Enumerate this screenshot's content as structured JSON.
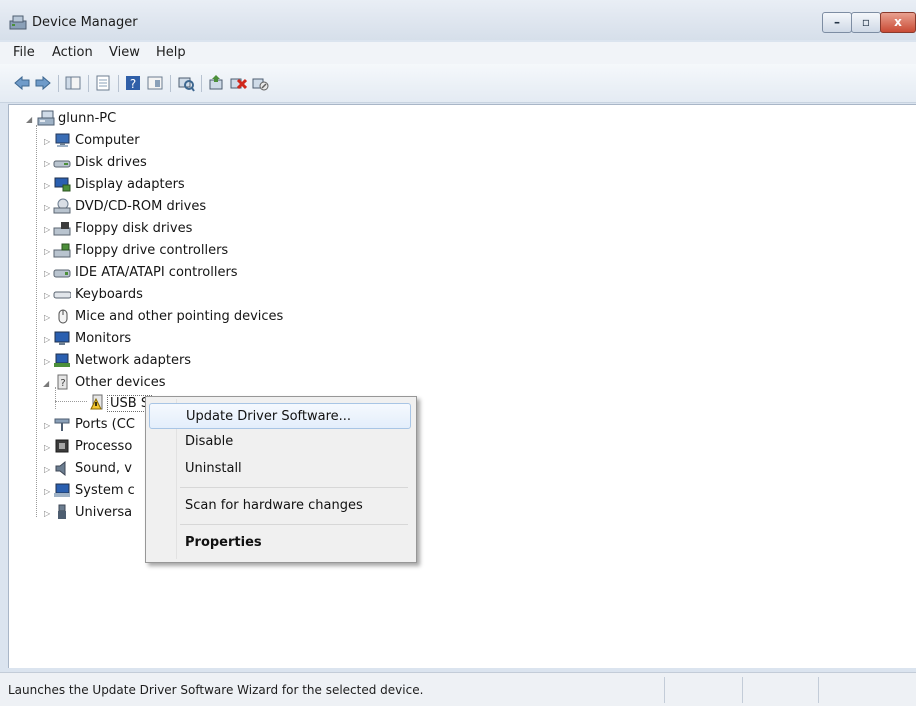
{
  "window": {
    "title": "Device Manager",
    "buttons": {
      "minimize": "–",
      "maximize": "▫",
      "close": "x"
    }
  },
  "menu": {
    "file": "File",
    "action": "Action",
    "view": "View",
    "help": "Help"
  },
  "toolbar": {
    "icons": [
      "back-arrow-icon",
      "forward-arrow-icon",
      "show-hide-tree-icon",
      "properties-icon",
      "help-icon",
      "view-icon",
      "scan-hardware-icon",
      "update-driver-icon",
      "uninstall-device-icon",
      "disable-device-icon"
    ]
  },
  "tree": {
    "root": "glunn-PC",
    "categories": [
      "Computer",
      "Disk drives",
      "Display adapters",
      "DVD/CD-ROM drives",
      "Floppy disk drives",
      "Floppy drive controllers",
      "IDE ATA/ATAPI controllers",
      "Keyboards",
      "Mice and other pointing devices",
      "Monitors",
      "Network adapters",
      "Other devices"
    ],
    "selected_device": "USB S",
    "categories_after": [
      "Ports (CC",
      "Processo",
      "Sound, v",
      "System c",
      "Universa"
    ]
  },
  "context_menu": {
    "items": [
      "Update Driver Software...",
      "Disable",
      "Uninstall",
      "Scan for hardware changes",
      "Properties"
    ]
  },
  "status": {
    "text": "Launches the Update Driver Software Wizard for the selected device."
  },
  "colors": {
    "menu_highlight": "#e3eefb",
    "close_button": "#c94b35",
    "title_bg": "#dbe4ef"
  }
}
